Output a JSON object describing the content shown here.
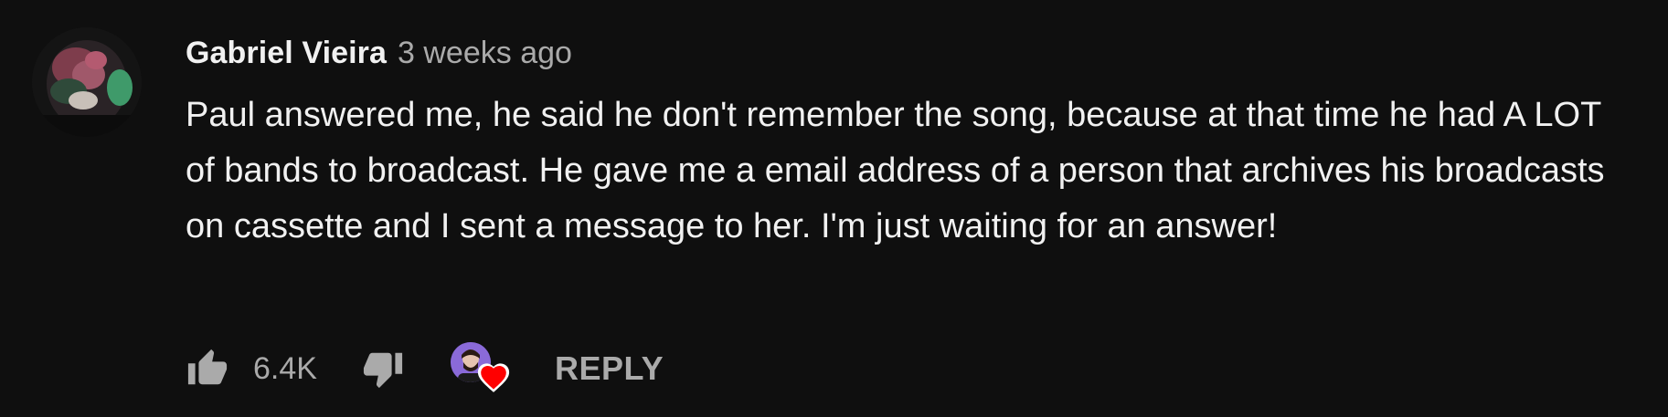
{
  "comment": {
    "author": "Gabriel Vieira",
    "timestamp": "3 weeks ago",
    "text": "Paul answered me, he said he don't remember the song, because at that time he had A LOT of bands to broadcast. He gave me a email address of a person that archives his broadcasts on cassette and I sent a message to her. I'm just waiting for an answer!",
    "like_count": "6.4K",
    "reply_label": "REPLY"
  },
  "icons": {
    "like": "thumb-up-icon",
    "dislike": "thumb-down-icon",
    "creator_heart": "heart-icon"
  },
  "colors": {
    "background": "#0f0f0f",
    "text_primary": "#f1f1f1",
    "text_secondary": "#aaaaaa",
    "heart": "#ff0000"
  }
}
